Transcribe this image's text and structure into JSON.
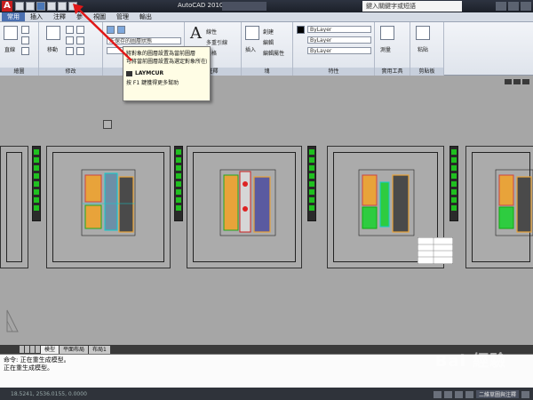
{
  "titlebar": {
    "app_title": "AutoCAD 2010",
    "search_placeholder": "鍵入關鍵字或短語"
  },
  "ribbon_tabs": [
    "常用",
    "插入",
    "注釋",
    "參",
    "視圖",
    "管理",
    "輸出"
  ],
  "ribbon": {
    "panels": [
      "繪圖",
      "修改",
      "圖層",
      "注釋",
      "塊",
      "特性",
      "實用工具",
      "剪貼板"
    ],
    "draw_label": "直線",
    "modify_label": "移動",
    "layer_state": "未保存的圖層狀態",
    "annotation": {
      "linear": "線性",
      "multileader": "多重引線",
      "table": "表格"
    },
    "block": {
      "insert": "插入",
      "create": "創建",
      "edit": "編輯",
      "edit_attr": "編輯屬性"
    },
    "properties": {
      "color": "ByLayer",
      "linetype": "ByLayer",
      "lineweight": "ByLayer"
    },
    "utilities": {
      "measure": "測量"
    },
    "clipboard": {
      "paste": "粘貼"
    }
  },
  "tooltip": {
    "line1": "將對象的圖層設置為當前圖層",
    "line2": "可將當前圖層設置為選定對象所在的圖層",
    "command": "LAYMCUR",
    "help": "按 F1 鍵獲得更多幫助"
  },
  "layout_tabs": [
    "模型",
    "平面布局",
    "布局1"
  ],
  "command_lines": [
    "命令: 正在重生成模型。",
    "正在重生成模型。"
  ],
  "watermark": "Bai 經驗",
  "statusbar": {
    "coords": "18.5241, 2536.0155, 0.0000",
    "view_label": "二維草圖與注釋"
  },
  "colors": {
    "accent": "#4a6fb0",
    "canvas": "#a6a6a6",
    "annotation_red": "#e01818"
  }
}
